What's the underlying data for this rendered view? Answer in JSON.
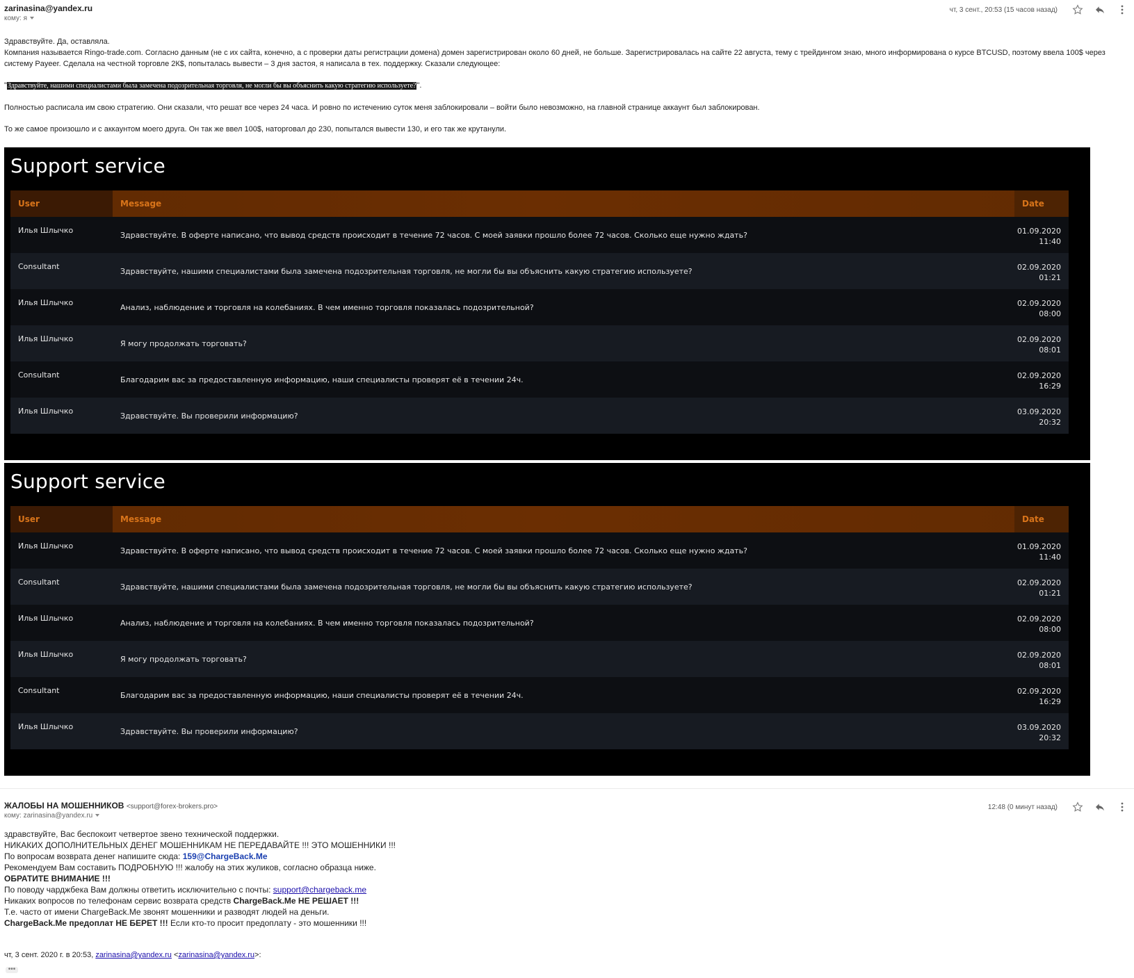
{
  "email1": {
    "sender": "zarinasina@yandex.ru",
    "to": "кому: я",
    "date": "чт, 3 сент., 20:53 (15 часов назад)",
    "body": [
      "Здравствуйте.  Да, оставляла.",
      "Компания называется Ringo-trade.com. Согласно данным (не с их сайта, конечно, а с проверки даты регистрации домена) домен зарегистрирован около 60 дней, не больше. Зарегистрировалась на сайте 22 августа, тему с трейдингом знаю, много информирована о курсе BTCUSD, поэтому ввела 100$ через систему Payeer. Сделала на честной торговле 2К$, попыталась вывести – 3 дня застоя, я написала в тех. поддержку. Сказали следующее:"
    ],
    "quote_open": "\"",
    "quote": "Здравствуйте, нашими специалистами была замечена подозрительная торговля, не могли бы вы объяснить какую стратегию используете?",
    "quote_close": "\".",
    "body2": "Полностью расписала им свою стратегию. Они сказали, что решат все через 24 часа. И ровно по истечению суток меня заблокировали – войти было невозможно, на главной странице аккаунт был заблокирован.",
    "body3": "То же самое произошло и с аккаунтом моего друга. Он так же ввел 100$, наторговал до 230, попытался вывести 130, и его так же крутанули."
  },
  "support": {
    "title": "Support service",
    "headers": {
      "user": "User",
      "message": "Message",
      "date": "Date"
    },
    "rows": [
      {
        "user": "Илья Шлычко",
        "message": "Здравствуйте. В оферте написано, что вывод средств происходит в течение 72 часов. С моей заявки прошло более 72 часов. Сколько еще нужно ждать?",
        "date": "01.09.2020",
        "time": "11:40"
      },
      {
        "user": "Consultant",
        "message": "Здравствуйте, нашими специалистами была замечена подозрительная торговля, не могли бы вы объяснить какую стратегию используете?",
        "date": "02.09.2020",
        "time": "01:21"
      },
      {
        "user": "Илья Шлычко",
        "message": "Анализ, наблюдение и торговля на колебаниях. В чем именно торговля показалась подозрительной?",
        "date": "02.09.2020",
        "time": "08:00"
      },
      {
        "user": "Илья Шлычко",
        "message": "Я могу продолжать торговать?",
        "date": "02.09.2020",
        "time": "08:01"
      },
      {
        "user": "Consultant",
        "message": "Благодарим вас за предоставленную информацию, наши специалисты проверят её в течении 24ч.",
        "date": "02.09.2020",
        "time": "16:29"
      },
      {
        "user": "Илья Шлычко",
        "message": "Здравствуйте. Вы проверили информацию?",
        "date": "03.09.2020",
        "time": "20:32"
      }
    ]
  },
  "email2": {
    "sender": "ЖАЛОБЫ НА МОШЕННИКОВ",
    "sender_email": "<support@forex-brokers.pro>",
    "to": "кому: zarinasina@yandex.ru",
    "date": "12:48 (0 минут назад)",
    "line1": "здравствуйте, Вас беспокоит четвертое звено технической поддержки.",
    "line2": "НИКАКИХ ДОПОЛНИТЕЛЬНЫХ ДЕНЕГ МОШЕННИКАМ НЕ ПЕРЕДАВАЙТЕ !!! ЭТО МОШЕННИКИ !!!",
    "line3_prefix": "По вопросам возврата денег напишите сюда: ",
    "line3_email": "159@ChargeBack.Me",
    "line4": "Рекомендуем Вам составить ПОДРОБНУЮ !!! жалобу на этих жуликов, согласно образца ниже.",
    "line5": "ОБРАТИТЕ ВНИМАНИЕ !!!",
    "line6_prefix": "По поводу чарджбека Вам должны ответить исключительно с почты: ",
    "line6_link": "support@chargeback.me",
    "line7_prefix": "Никаких вопросов по телефонам сервис возврата средств ",
    "line7_bold": "ChargeBack.Me НЕ РЕШАЕТ !!!",
    "line8": "Т.е. часто от имени ChargeBack.Me звонят мошенники и разводят людей на деньги.",
    "line9_bold": "ChargeBack.Me предоплат НЕ БЕРЕТ !!!",
    "line9_rest": " Если кто-то просит предоплату - это мошенники !!!",
    "quote_prefix": "чт, 3 сент. 2020 г. в 20:53, ",
    "quote_link1": "zarinasina@yandex.ru",
    "quote_mid": " <",
    "quote_link2": "zarinasina@yandex.ru",
    "quote_suffix": ">:",
    "ellipsis": "•••"
  }
}
